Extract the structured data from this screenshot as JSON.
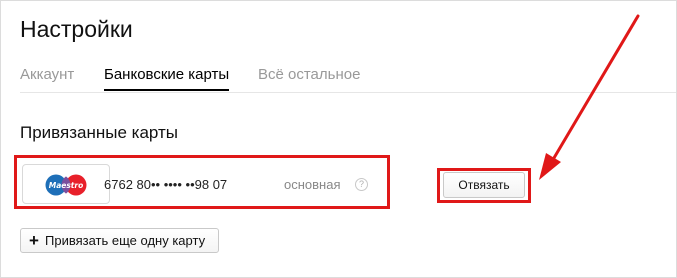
{
  "page": {
    "title": "Настройки"
  },
  "tabs": [
    {
      "label": "Аккаунт",
      "active": false
    },
    {
      "label": "Банковские карты",
      "active": true
    },
    {
      "label": "Всё остальное",
      "active": false
    }
  ],
  "section": {
    "title": "Привязанные карты"
  },
  "card": {
    "brand": "Maestro",
    "number": "6762 80•• •••• ••98 07",
    "status": "основная",
    "help": "?",
    "unlink_label": "Отвязать"
  },
  "add_card": {
    "label": "Привязать еще одну карту"
  },
  "colors": {
    "highlight": "#e01818",
    "arrow": "#e01818",
    "maestro_blue": "#1e6fb8",
    "maestro_red": "#e8202a"
  },
  "icons": {
    "brand_logo": "maestro-logo-icon",
    "help": "question-circle-icon",
    "add": "plus-icon",
    "annotation": "red-arrow-icon"
  }
}
